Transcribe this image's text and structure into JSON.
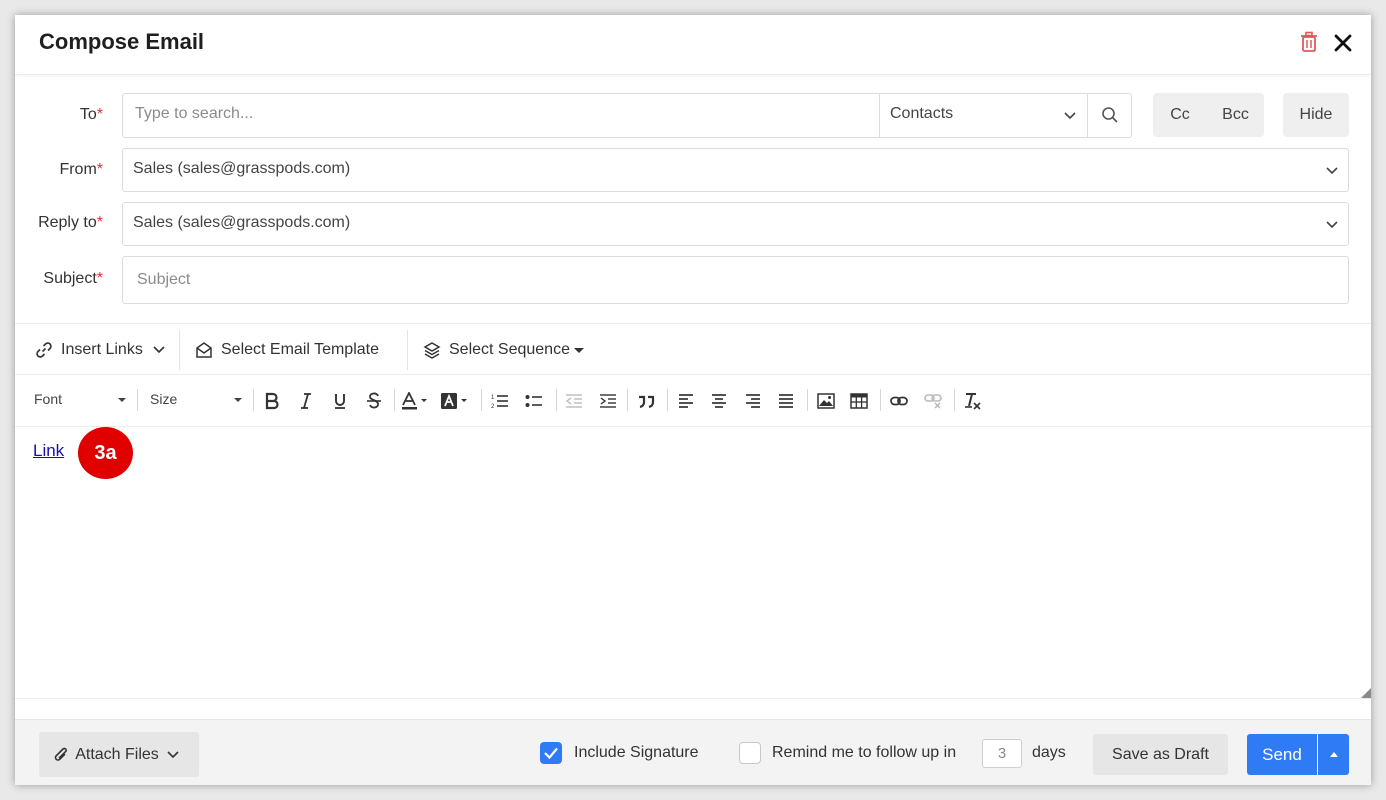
{
  "dialog": {
    "title": "Compose Email"
  },
  "form": {
    "to": {
      "label": "To",
      "placeholder": "Type to search...",
      "source": "Contacts"
    },
    "from": {
      "label": "From",
      "value": "Sales (sales@grasspods.com)"
    },
    "reply_to": {
      "label": "Reply to",
      "value": "Sales (sales@grasspods.com)"
    },
    "subject": {
      "label": "Subject",
      "placeholder": "Subject"
    },
    "required_marker": "*",
    "cc_label": "Cc",
    "bcc_label": "Bcc",
    "hide_label": "Hide"
  },
  "toolbar": {
    "insert_links": "Insert Links",
    "select_template": "Select Email Template",
    "select_sequence": "Select Sequence"
  },
  "editor": {
    "font_label": "Font",
    "size_label": "Size",
    "content_link": "Link",
    "callout": "3a"
  },
  "footer": {
    "attach_files": "Attach Files",
    "include_signature": "Include Signature",
    "include_signature_checked": true,
    "remind_label": "Remind me to follow up in",
    "remind_checked": false,
    "remind_days": "3",
    "days_label": "days",
    "save_draft": "Save as Draft",
    "send": "Send"
  },
  "colors": {
    "primary": "#2f7bf5",
    "required": "#e03131",
    "delete": "#e05a5a",
    "callout": "#e00000"
  }
}
